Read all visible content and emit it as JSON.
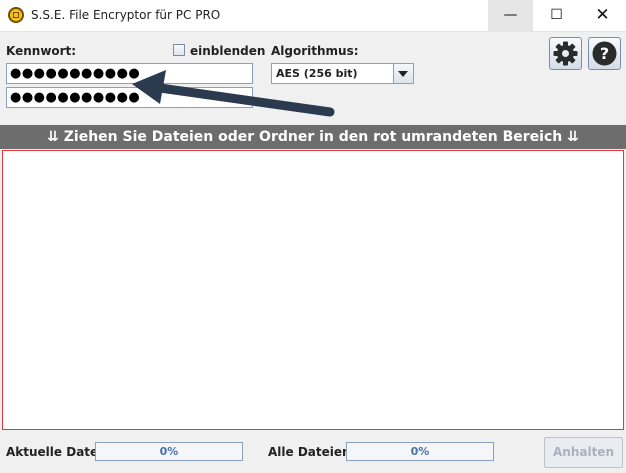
{
  "window": {
    "title": "S.S.E. File Encryptor für PC PRO",
    "minimize_glyph": "—",
    "maximize_glyph": "☐",
    "close_glyph": "✕"
  },
  "password": {
    "label": "Kennwort:",
    "field1_value": "●●●●●●●●●●●",
    "field2_value": "●●●●●●●●●●●",
    "show_label": "einblenden",
    "show_checked": false
  },
  "algorithm": {
    "label": "Algorithmus:",
    "selected": "AES (256 bit)"
  },
  "toolbar": {
    "settings_icon": "gear-icon",
    "help_icon": "question-icon"
  },
  "dropzone": {
    "banner": "⇊ Ziehen Sie Dateien oder Ordner in den rot umrandeten Bereich ⇊",
    "border_color": "#e0383e"
  },
  "status": {
    "current_label": "Aktuelle Datei:",
    "current_progress": "0%",
    "all_label": "Alle Dateien:",
    "all_progress": "0%",
    "halt_button": "Anhalten",
    "halt_enabled": false
  },
  "annotation": {
    "arrow_color": "#2b3a4e"
  }
}
